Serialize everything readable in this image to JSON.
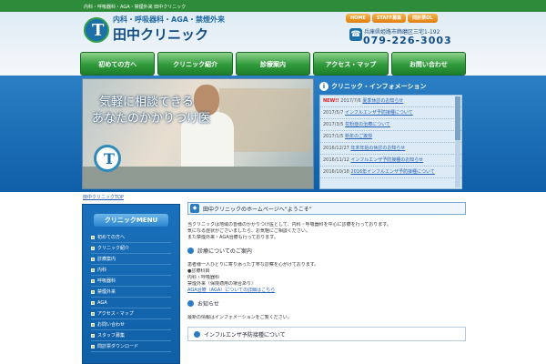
{
  "topbar": {
    "tagline": "内科・呼吸器科・AGA・禁煙外来 田中クリニック"
  },
  "header": {
    "specialties": "内科・呼吸器科・AGA・禁煙外来",
    "clinic_name": "田中クリニック",
    "logo_letter": "T",
    "buttons": [
      "HOME",
      "STAFF募集",
      "問診票DL"
    ],
    "address": "兵庫県姫路市飾磨区三宅1-192",
    "tel": "079-226-3003",
    "phone_icon": "☎"
  },
  "nav": [
    "初めての方へ",
    "クリニック紹介",
    "診療案内",
    "アクセス・マップ",
    "お問い合わせ"
  ],
  "hero": {
    "copy_line1": "気軽に相談できる",
    "copy_line2": "あなたのかかりつけ医",
    "logo_letter": "T"
  },
  "info": {
    "title": "クリニック・インフォメーション",
    "icon": "i",
    "items": [
      {
        "badge": "NEW!!",
        "date": "2017/7/6",
        "text": "夏季休診のお知らせ"
      },
      {
        "badge": "",
        "date": "2017/5/7",
        "text": "インフルエンザ予防接種について"
      },
      {
        "badge": "",
        "date": "2017/3/5",
        "text": "花粉症の治療について"
      },
      {
        "badge": "",
        "date": "2017/1/5",
        "text": "新年のご挨拶"
      },
      {
        "badge": "",
        "date": "2016/12/27",
        "text": "年末年始の休診のお知らせ"
      },
      {
        "badge": "",
        "date": "2016/11/12",
        "text": "インフルエンザ予防接種のお知らせ"
      },
      {
        "badge": "",
        "date": "2016/10/18",
        "text": "2016年インフルエンザ予防接種について"
      }
    ]
  },
  "breadcrumb": "田中クリニックTOP",
  "sidebar": {
    "title": "クリニックMENU",
    "items": [
      "初めての方へ",
      "クリニック紹介",
      "診療案内",
      "内科",
      "呼吸器科",
      "禁煙外来",
      "AGA",
      "アクセス・マップ",
      "お問い合わせ",
      "スタッフ募集",
      "問診票ダウンロード"
    ]
  },
  "main": {
    "title": "田中クリニックのホームページへ“ようこそ”",
    "title_icon": "◆",
    "intro": [
      "当クリニックは地域の皆様のかかりつけ医として、内科・呼吸器科を中心に診療を行っております。",
      "気になる症状がございましたら、お気軽にご相談ください。",
      "また禁煙外来・AGA治療も行っております。"
    ],
    "section1_title": "診療についてのご案内",
    "section1_lines": [
      "患者様一人ひとりに寄り添った丁寧な診察を心がけております。",
      "●診療科目",
      "内科・呼吸器科",
      "禁煙外来（保険適用の場合あり）"
    ],
    "section1_link": "AGA治療（AGA）についての詳細はこちら",
    "section2_title": "お知らせ",
    "section2_line": "最新の情報はインフォメーションをご覧ください。",
    "box_title": "インフルエンザ予防接種について"
  }
}
